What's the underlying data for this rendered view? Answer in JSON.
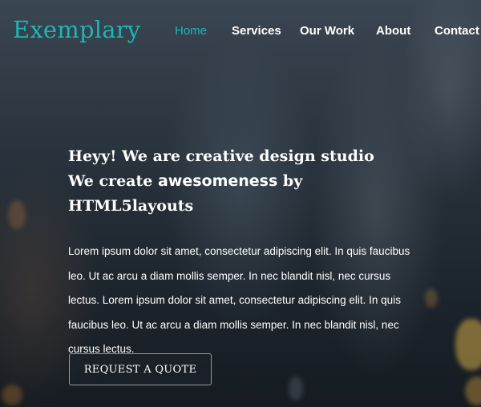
{
  "brand": {
    "logo_text": "Exemplary",
    "accent_color": "#1fb5b5"
  },
  "nav": {
    "items": [
      {
        "label": "Home",
        "active": true
      },
      {
        "label": "Services",
        "active": false
      },
      {
        "label": "Our Work",
        "active": false
      },
      {
        "label": "About",
        "active": false
      },
      {
        "label": "Contact",
        "active": false
      }
    ]
  },
  "hero": {
    "line1": "Heyy! We are creative design studio",
    "line2_prefix": "We create ",
    "line2_emphasis": "awesomeness",
    "line2_suffix": " by HTML5layouts",
    "body": "Lorem ipsum dolor sit amet, consectetur adipiscing elit. In quis faucibus leo. Ut ac arcu a diam mollis semper. In nec blandit nisl, nec cursus lectus. Lorem ipsum dolor sit amet, consectetur adipiscing elit. In quis faucibus leo. Ut ac arcu a diam mollis semper. In nec blandit nisl, nec cursus lectus.",
    "cta_label": "REQUEST A QUOTE"
  }
}
